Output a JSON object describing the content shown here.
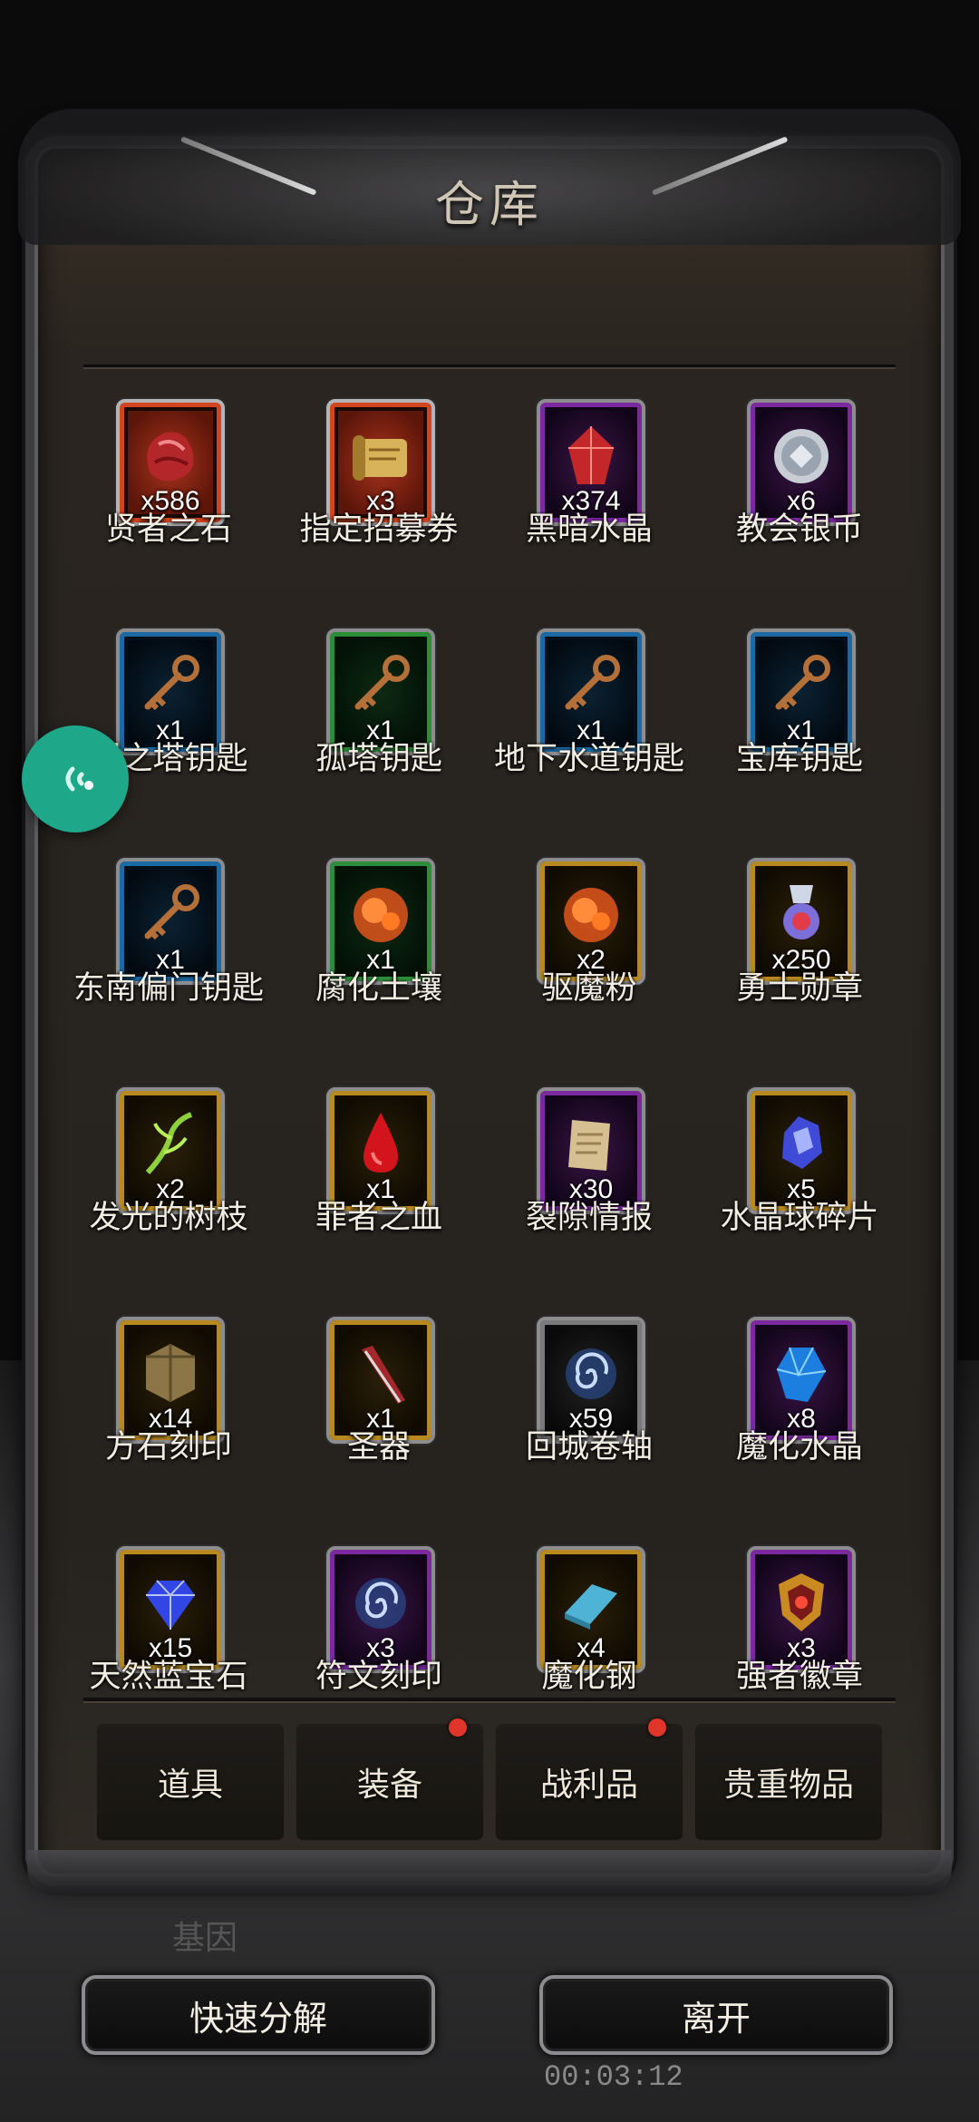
{
  "window": {
    "title": "仓库"
  },
  "items": [
    {
      "name": "贤者之石",
      "qty": "x586",
      "rarity": "red",
      "icon": "red-stone-icon"
    },
    {
      "name": "指定招募券",
      "qty": "x3",
      "rarity": "red",
      "icon": "scroll-icon"
    },
    {
      "name": "黑暗水晶",
      "qty": "x374",
      "rarity": "purple",
      "icon": "red-crystal-icon"
    },
    {
      "name": "教会银币",
      "qty": "x6",
      "rarity": "purple",
      "icon": "silver-coin-icon"
    },
    {
      "name": "罪之塔钥匙",
      "qty": "x1",
      "rarity": "blue",
      "icon": "key-icon"
    },
    {
      "name": "孤塔钥匙",
      "qty": "x1",
      "rarity": "green",
      "icon": "key-icon"
    },
    {
      "name": "地下水道钥匙",
      "qty": "x1",
      "rarity": "blue",
      "icon": "key-icon"
    },
    {
      "name": "宝库钥匙",
      "qty": "x1",
      "rarity": "blue",
      "icon": "key-icon"
    },
    {
      "name": "东南偏门钥匙",
      "qty": "x1",
      "rarity": "blue",
      "icon": "key-icon"
    },
    {
      "name": "腐化土壤",
      "qty": "x1",
      "rarity": "green",
      "icon": "orange-dust-icon"
    },
    {
      "name": "驱魔粉",
      "qty": "x2",
      "rarity": "gold",
      "icon": "orange-dust-icon"
    },
    {
      "name": "勇士勋章",
      "qty": "x250",
      "rarity": "gold",
      "icon": "medal-icon"
    },
    {
      "name": "发光的树枝",
      "qty": "x2",
      "rarity": "gold",
      "icon": "branch-icon"
    },
    {
      "name": "罪者之血",
      "qty": "x1",
      "rarity": "gold",
      "icon": "blood-drop-icon"
    },
    {
      "name": "裂隙情报",
      "qty": "x30",
      "rarity": "purple",
      "icon": "paper-icon"
    },
    {
      "name": "水晶球碎片",
      "qty": "x5",
      "rarity": "gold",
      "icon": "crystal-shard-icon"
    },
    {
      "name": "方石刻印",
      "qty": "x14",
      "rarity": "gold",
      "icon": "stone-block-icon"
    },
    {
      "name": "圣器",
      "qty": "x1",
      "rarity": "gold",
      "icon": "relic-blade-icon"
    },
    {
      "name": "回城卷轴",
      "qty": "x59",
      "rarity": "gray",
      "icon": "swirl-icon"
    },
    {
      "name": "魔化水晶",
      "qty": "x8",
      "rarity": "purple",
      "icon": "blue-crystal-icon"
    },
    {
      "name": "天然蓝宝石",
      "qty": "x15",
      "rarity": "gold",
      "icon": "sapphire-icon"
    },
    {
      "name": "符文刻印",
      "qty": "x3",
      "rarity": "purple",
      "icon": "swirl-icon"
    },
    {
      "name": "魔化钢",
      "qty": "x4",
      "rarity": "gold",
      "icon": "steel-ingot-icon"
    },
    {
      "name": "强者徽章",
      "qty": "x3",
      "rarity": "purple",
      "icon": "badge-icon"
    }
  ],
  "tabs": [
    {
      "label": "道具",
      "badge": false
    },
    {
      "label": "装备",
      "badge": true
    },
    {
      "label": "战利品",
      "badge": true
    },
    {
      "label": "贵重物品",
      "badge": false
    }
  ],
  "actions": {
    "decompose": "快速分解",
    "leave": "离开"
  },
  "status": {
    "timer": "00:03:12",
    "background_label": "基因"
  },
  "colors": {
    "red": "#d2451f",
    "purple": "#7c29a0",
    "blue": "#1c6aa3",
    "green": "#2c8d3a",
    "gold": "#b8891f",
    "gray": "#7a7a7a",
    "badge": "#e0352a",
    "floating": "#1ea889"
  }
}
